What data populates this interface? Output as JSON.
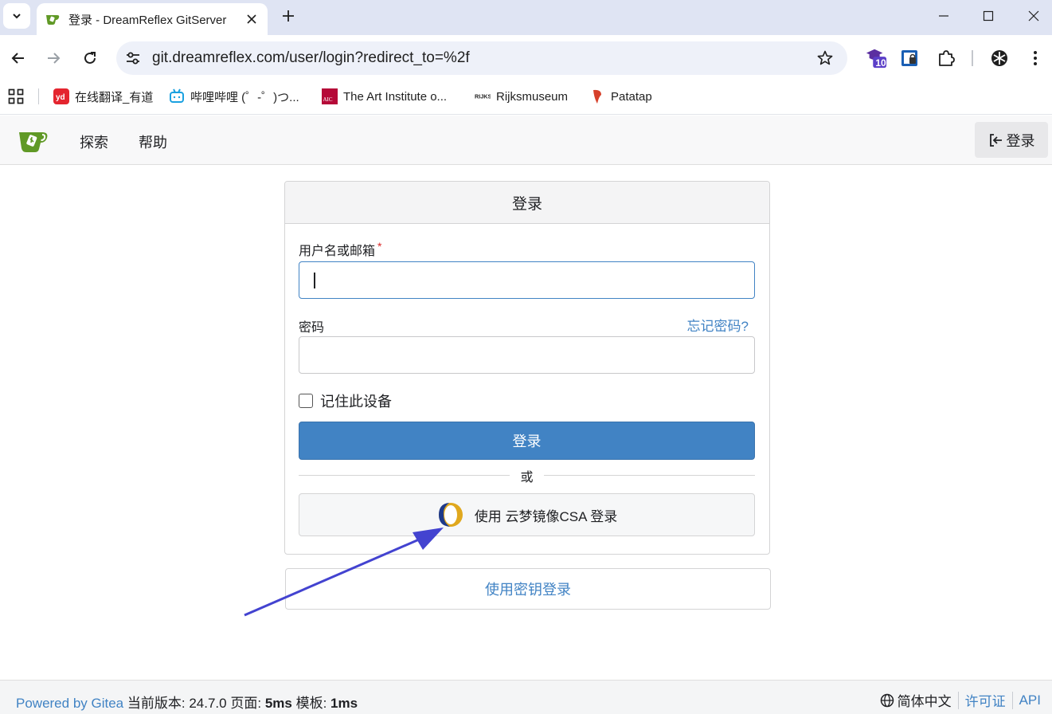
{
  "browser": {
    "tab": {
      "title": "登录 - DreamReflex GitServer"
    },
    "url": "git.dreamreflex.com/user/login?redirect_to=%2f",
    "extension_badge": "10",
    "bookmarks": [
      {
        "label": "在线翻译_有道",
        "icon": "youdao-icon"
      },
      {
        "label": "哔哩哔哩 (゜-゜)つ...",
        "icon": "bilibili-icon"
      },
      {
        "label": "The Art Institute o...",
        "icon": "aic-icon"
      },
      {
        "label": "Rijksmuseum",
        "icon": "rijks-icon"
      },
      {
        "label": "Patatap",
        "icon": "patatap-icon"
      }
    ]
  },
  "gitea": {
    "nav": {
      "explore": "探索",
      "help": "帮助",
      "signin": "登录"
    },
    "login": {
      "title": "登录",
      "username_label": "用户名或邮箱",
      "required_mark": "*",
      "username_value": "",
      "password_label": "密码",
      "forgot": "忘记密码?",
      "remember": "记住此设备",
      "submit": "登录",
      "or": "或",
      "oauth": "使用 云梦镜像CSA 登录",
      "passkey": "使用密钥登录"
    },
    "footer": {
      "powered": "Powered by Gitea",
      "version_label": "当前版本:",
      "version": "24.7.0",
      "page_label": "页面:",
      "page_time": "5ms",
      "template_label": "模板:",
      "template_time": "1ms",
      "language": "简体中文",
      "license": "许可证",
      "api": "API"
    }
  },
  "colors": {
    "primary": "#4183c4",
    "tabstrip": "#dfe4f3",
    "annotation_arrow": "#4343d0"
  }
}
